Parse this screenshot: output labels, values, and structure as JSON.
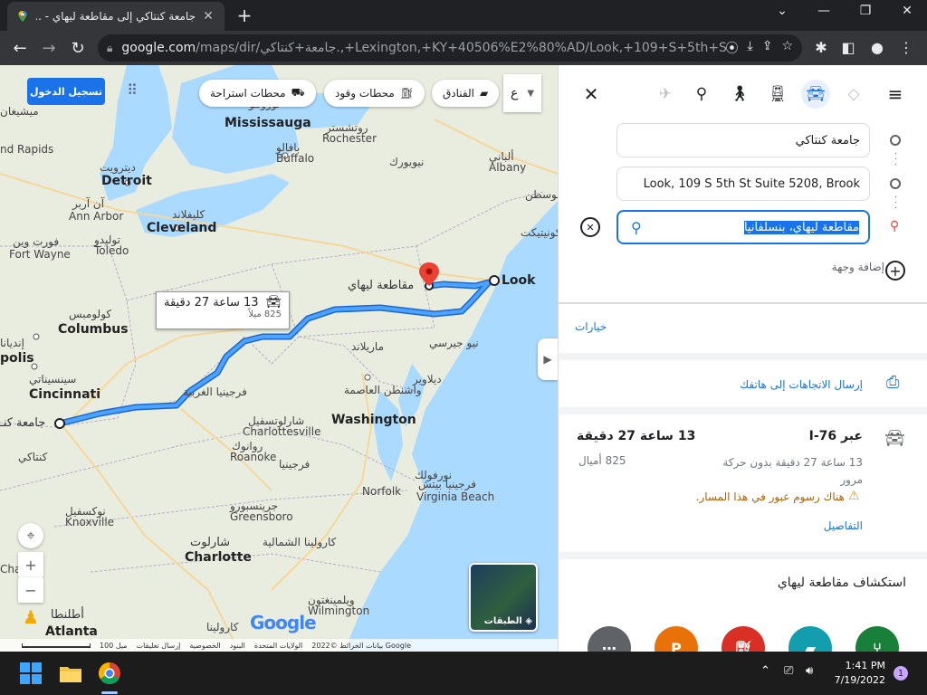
{
  "browser": {
    "tab_title": "جامعة كنتاكي إلى مقاطعة ليهاي - ...",
    "url_host": "google.com",
    "url_path": "/maps/dir/جامعة+كنتاكي.,+Lexington,+KY+40506%E2%80%AD/Look,+109+S+5th+St..."
  },
  "map": {
    "signin_label": "تسجيل الدخول",
    "chips": [
      "محطات استراحة",
      "محطات وقود",
      "الفنادق"
    ],
    "route_summary": {
      "time": "13 ساعة 27 دقيقة",
      "distance": "825 ميلاً"
    },
    "labels": {
      "toronto": "تورونتو",
      "mississauga": "Mississauga",
      "rochester_ar": "روتشستر",
      "rochester": "Rochester",
      "buffalo_ar": "بافالو",
      "buffalo": "Buffalo",
      "new_york_state": "نيويورك",
      "albany_ar": "ألباني",
      "albany": "Albany",
      "boston": "بوسطن",
      "connecticut": "كونيتيكت",
      "detroit_ar": "ديترويت",
      "detroit": "Detroit",
      "ann_arbor_ar": "آن آربر",
      "ann_arbor": "Ann Arbor",
      "cleveland_ar": "كليفلاند",
      "cleveland": "Cleveland",
      "michigan": "ميشيغان",
      "grand_rapids": "nd Rapids",
      "fort_wayne_ar": "فورت وين",
      "fort_wayne": "Fort Wayne",
      "toledo_ar": "توليدو",
      "toledo": "Toledo",
      "columbus_ar": "كولومبس",
      "columbus": "Columbus",
      "indiana": "إنديانا",
      "indianapolis": "polis",
      "cincinnati_ar": "سينسيناتي",
      "cincinnati": "Cincinnati",
      "kentucky_uni": "جامعة كنـ",
      "kentucky": "كنتاكي",
      "west_virginia": "فرجينيا الغربية",
      "maryland": "ماريلاند",
      "delaware": "ديلاوير",
      "new_jersey": "نيو جيرسي",
      "washington_ar": "واشنطن العاصمة",
      "washington": "Washington",
      "charlottesville_ar": "شارلوتسفيل",
      "charlottesville": "Charlottesville",
      "roanoke_ar": "روانوك",
      "roanoke": "Roanoke",
      "virginia": "فرجينيا",
      "norfolk_ar": "نورفولك",
      "norfolk": "Norfolk",
      "virginia_beach_ar": "فرجينيا بيتش",
      "virginia_beach": "Virginia Beach",
      "knoxville_ar": "نوكسفيل",
      "knoxville": "Knoxville",
      "greensboro_ar": "جرينسبورو",
      "greensboro": "Greensboro",
      "charlotte_ar": "شارلوت",
      "charlotte": "Charlotte",
      "north_carolina": "كارولينا الشمالية",
      "wilmington_ar": "ويلمينغتون",
      "wilmington": "Wilmington",
      "atlanta_ar": "أطلنطا",
      "atlanta": "Atlanta",
      "south_carolina": "كارولينا",
      "chattanooga": "Cha",
      "lehigh": "مقاطعة ليهاي",
      "look": "Look"
    },
    "layers_label": "الطبقات",
    "google_logo": "Google",
    "footer": [
      "بيانات الخرائط ©2022 Google",
      "الولايات المتحدة",
      "البنود",
      "الخصوصية",
      "إرسال تعليقات",
      "100 ميل"
    ],
    "search_cut_text": "ع"
  },
  "panel": {
    "origin": "جامعة كنتاكي",
    "stop": "Look, 109 S 5th St Suite 5208, Brook",
    "destination": "مقاطعة ليهاي، بنسلفانيا",
    "add_destination": "إضافة وجهة",
    "options": "خيارات",
    "send_to_phone": "إرسال الاتجاهات إلى هاتفك",
    "route": {
      "via": "عبر I-76",
      "time": "13 ساعة 27 دقيقة",
      "no_traffic": "13 ساعة 27 دقيقة بدون حركة مرور",
      "distance": "825 أميال",
      "toll_warning": "هناك رسوم عبور في هذا المسار.",
      "details": "التفاصيل"
    },
    "explore": "استكشاف مقاطعة ليهاي",
    "parking_letter": "P"
  },
  "taskbar": {
    "time": "1:41 PM",
    "date": "7/19/2022",
    "notifications": "1"
  },
  "colors": {
    "route": "#4285f4",
    "route_outline": "#1967d2",
    "accent": "#1a73e8",
    "pin": "#ea4335"
  }
}
